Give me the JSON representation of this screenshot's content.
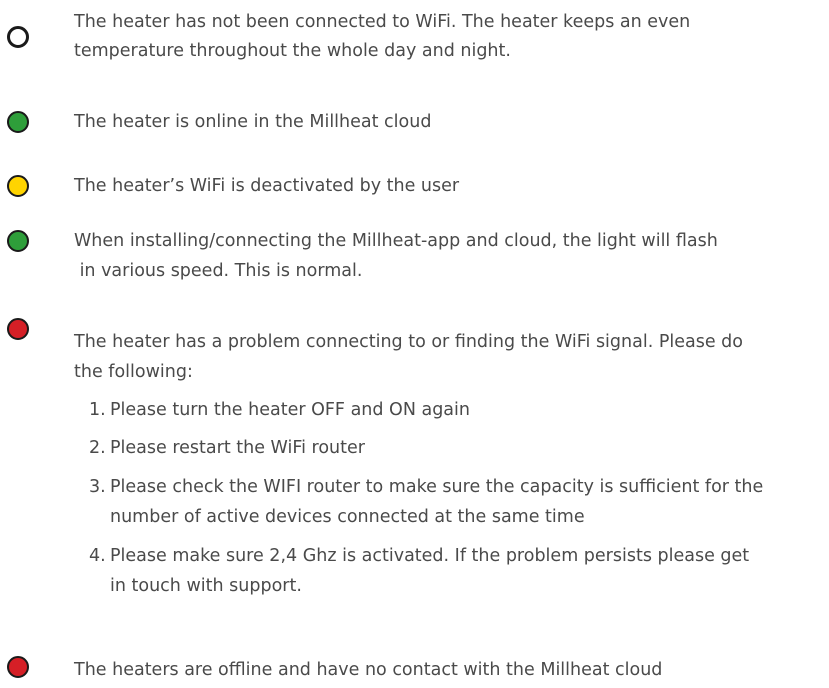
{
  "colors": {
    "off": "#ffffff",
    "green": "#2e9e3a",
    "yellow": "#ffd400",
    "red": "#d51f26",
    "text": "#4a4a4a"
  },
  "items": [
    {
      "indicator": "off",
      "lines": [
        "The heater has not been connected to WiFi. The heater keeps an even",
        "temperature throughout the whole day and night."
      ]
    },
    {
      "indicator": "green",
      "lines": [
        "The heater is online in the Millheat cloud"
      ]
    },
    {
      "indicator": "yellow",
      "lines": [
        "The heater’s WiFi is deactivated by the user"
      ]
    },
    {
      "indicator": "green",
      "lines": [
        "When installing/connecting the Millheat-app and cloud, the light will flash",
        " in various speed. This is normal."
      ]
    },
    {
      "indicator": "red",
      "lines": [
        "The heater has a problem connecting to or finding the WiFi signal. Please do",
        "the following:"
      ],
      "steps": [
        {
          "num": "1.",
          "lines": [
            "Please turn the heater OFF and ON again"
          ]
        },
        {
          "num": "2.",
          "lines": [
            "Please restart the WiFi router"
          ]
        },
        {
          "num": "3.",
          "lines": [
            "Please check the WIFI router to make sure the capacity is sufficient for the",
            "number of active devices connected at the same time"
          ]
        },
        {
          "num": "4.",
          "lines": [
            "Please make sure 2,4 Ghz is activated. If the problem persists please get",
            "in touch with support."
          ]
        }
      ]
    },
    {
      "indicator": "red",
      "lines": [
        "The heaters are offline and have no contact with the Millheat cloud"
      ]
    }
  ]
}
